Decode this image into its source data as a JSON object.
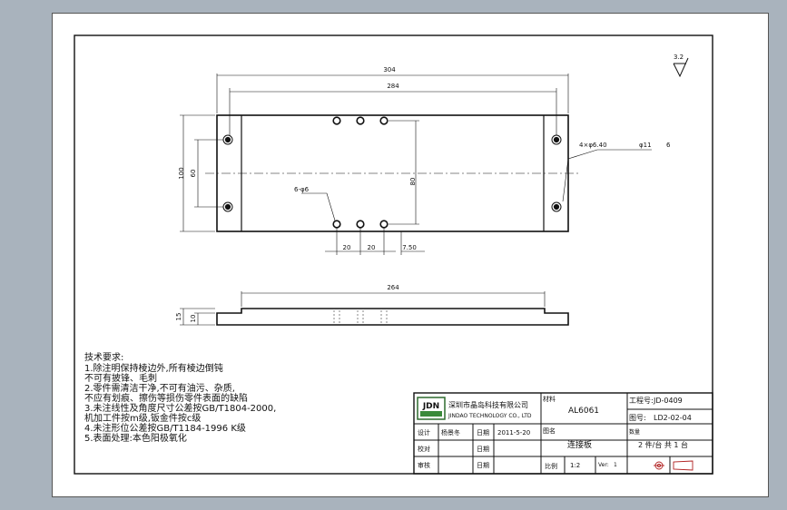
{
  "drawing": {
    "roughness": "3.2",
    "dims": {
      "overall_length": "304",
      "hole_spacing": "284",
      "height": "100",
      "hole_vertical": "60",
      "inner_height": "80",
      "hole_callout": "4×φ6.40",
      "hole_callout_cbore": "φ11",
      "hole_callout_depth": "6",
      "small_holes": "6-φ6",
      "pitch_1": "20",
      "pitch_2": "20",
      "offset": "7.50",
      "side_length": "264",
      "side_h1": "15",
      "side_h2": "10"
    }
  },
  "notes": {
    "heading": "技术要求:",
    "lines": [
      "1.除注明保持棱边外,所有棱边倒钝",
      "   不可有披锋、毛刺",
      "2.零件需清洁干净,不可有油污、杂质,",
      "   不应有划痕、擦伤等损伤零件表面的缺陷",
      "3.未注线性及角度尺寸公差按GB/T1804-2000,",
      "   机加工件按m级,钣金件按c级",
      "4.未注形位公差按GB/T1184-1996 K级",
      "5.表面处理:本色阳极氧化"
    ]
  },
  "title_block": {
    "logo_text": "JDN",
    "company_cn": "深圳市晶岛科技有限公司",
    "company_en": "JINDAO TECHNOLOGY CO., LTD",
    "material_label": "材料",
    "material_value": "AL6061",
    "project_label": "工程号:",
    "project_value": "JD-0409",
    "drawing_no_label": "图号:",
    "drawing_no_value": "LD2-02-04",
    "design_label": "设计",
    "designer": "杨景冬",
    "date_label": "日期",
    "date_value": "2011-5-20",
    "name_label": "图名",
    "name_value": "连接板",
    "qty_label": "数量",
    "qty_value": "2  件/台   共  1  台",
    "check_label": "校对",
    "check_date_label": "日期",
    "review_label": "审核",
    "review_date_label": "日期",
    "scale_label": "比例",
    "scale_value": "1:2",
    "ver_label": "Ver:",
    "ver_value": "1"
  }
}
